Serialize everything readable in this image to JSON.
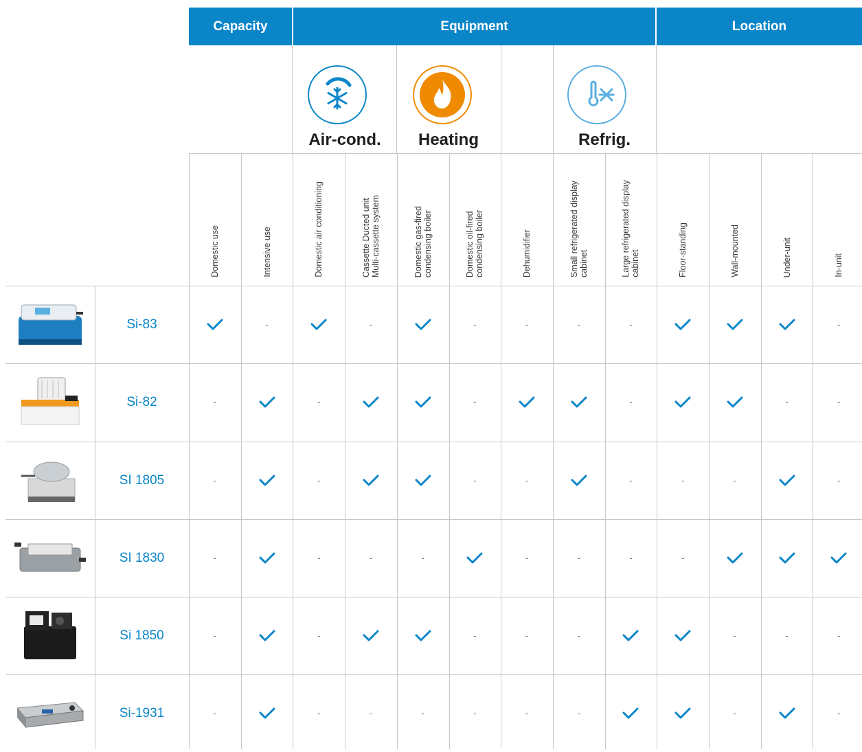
{
  "groups": {
    "capacity": "Capacity",
    "equipment": "Equipment",
    "location": "Location"
  },
  "categories": {
    "aircond": {
      "label": "Air-cond.",
      "icon": "snowflake-icon",
      "color": "#0a85c8"
    },
    "heating": {
      "label": "Heating",
      "icon": "flame-icon",
      "color": "#f08a00"
    },
    "refrig": {
      "label": "Refrig.",
      "icon": "thermometer-snowflake-icon",
      "color": "#5aaee0"
    }
  },
  "columns": [
    "Domestic use",
    "Intensive use",
    "Domestic air conditioning",
    "Cassette Ducted unit\nMulti-cassette system",
    "Domestic gas-fired\ncondensing boiler",
    "Domestic oil-fired\ncondensing boiler",
    "Dehumidifier",
    "Small refrigerated display\ncabinet",
    "Large refrigerated display\ncabinet",
    "Floor-standing",
    "Wall-mounted",
    "Under-unit",
    "In-unit"
  ],
  "dash": "-",
  "check_color": "#0a85c8",
  "rows": [
    {
      "model": "Si-83",
      "thumb": "blue-pump-photo",
      "values": [
        true,
        false,
        true,
        false,
        true,
        false,
        false,
        false,
        false,
        true,
        true,
        true,
        false
      ]
    },
    {
      "model": "Si-82",
      "thumb": "white-orange-pump-photo",
      "values": [
        false,
        true,
        false,
        true,
        true,
        false,
        true,
        true,
        false,
        true,
        true,
        false,
        false
      ]
    },
    {
      "model": "SI 1805",
      "thumb": "grey-tank-pump-photo",
      "values": [
        false,
        true,
        false,
        true,
        true,
        false,
        false,
        true,
        false,
        false,
        false,
        true,
        false
      ]
    },
    {
      "model": "SI 1830",
      "thumb": "grey-long-pump-photo",
      "values": [
        false,
        true,
        false,
        false,
        false,
        true,
        false,
        false,
        false,
        false,
        true,
        true,
        true
      ]
    },
    {
      "model": "Si 1850",
      "thumb": "black-tank-pump-photo",
      "values": [
        false,
        true,
        false,
        true,
        true,
        false,
        false,
        false,
        true,
        true,
        false,
        false,
        false
      ]
    },
    {
      "model": "Si-1931",
      "thumb": "steel-channel-pump-photo",
      "values": [
        false,
        true,
        false,
        false,
        false,
        false,
        false,
        false,
        true,
        true,
        false,
        true,
        false
      ]
    }
  ]
}
